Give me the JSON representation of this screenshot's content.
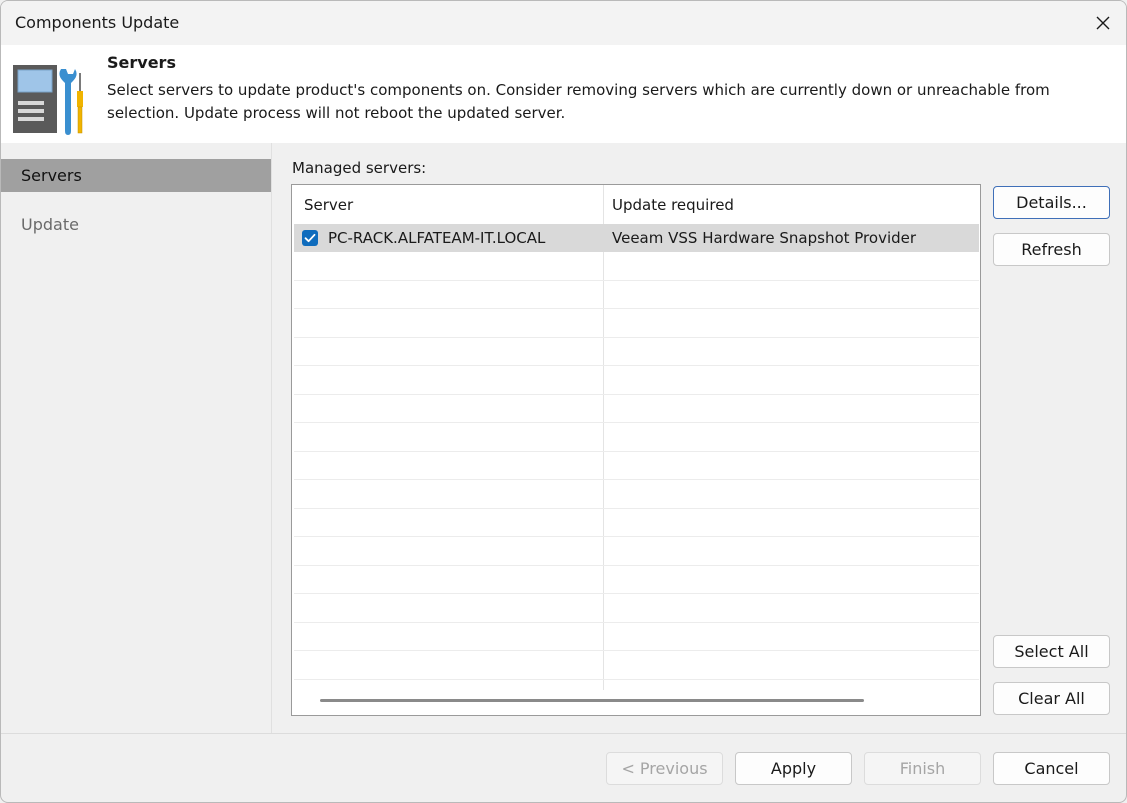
{
  "window": {
    "title": "Components Update"
  },
  "header": {
    "title": "Servers",
    "description": "Select servers to update product's components on. Consider removing servers which are currently down or unreachable from selection. Update process will not reboot the updated server."
  },
  "sidebar": {
    "items": [
      {
        "label": "Servers",
        "active": true
      },
      {
        "label": "Update",
        "active": false
      }
    ]
  },
  "main": {
    "label": "Managed servers:",
    "columns": [
      "Server",
      "Update required"
    ],
    "rows": [
      {
        "checked": true,
        "server": "PC-RACK.ALFATEAM-IT.LOCAL",
        "update_required": "Veeam VSS Hardware Snapshot Provider"
      }
    ]
  },
  "side_buttons": {
    "details": "Details...",
    "refresh": "Refresh",
    "select_all": "Select All",
    "clear_all": "Clear All"
  },
  "footer": {
    "previous": "< Previous",
    "apply": "Apply",
    "finish": "Finish",
    "cancel": "Cancel"
  },
  "colors": {
    "accent": "#0f6cbd",
    "active_nav": "#a0a0a0",
    "selected_row": "#d9d9d9"
  }
}
